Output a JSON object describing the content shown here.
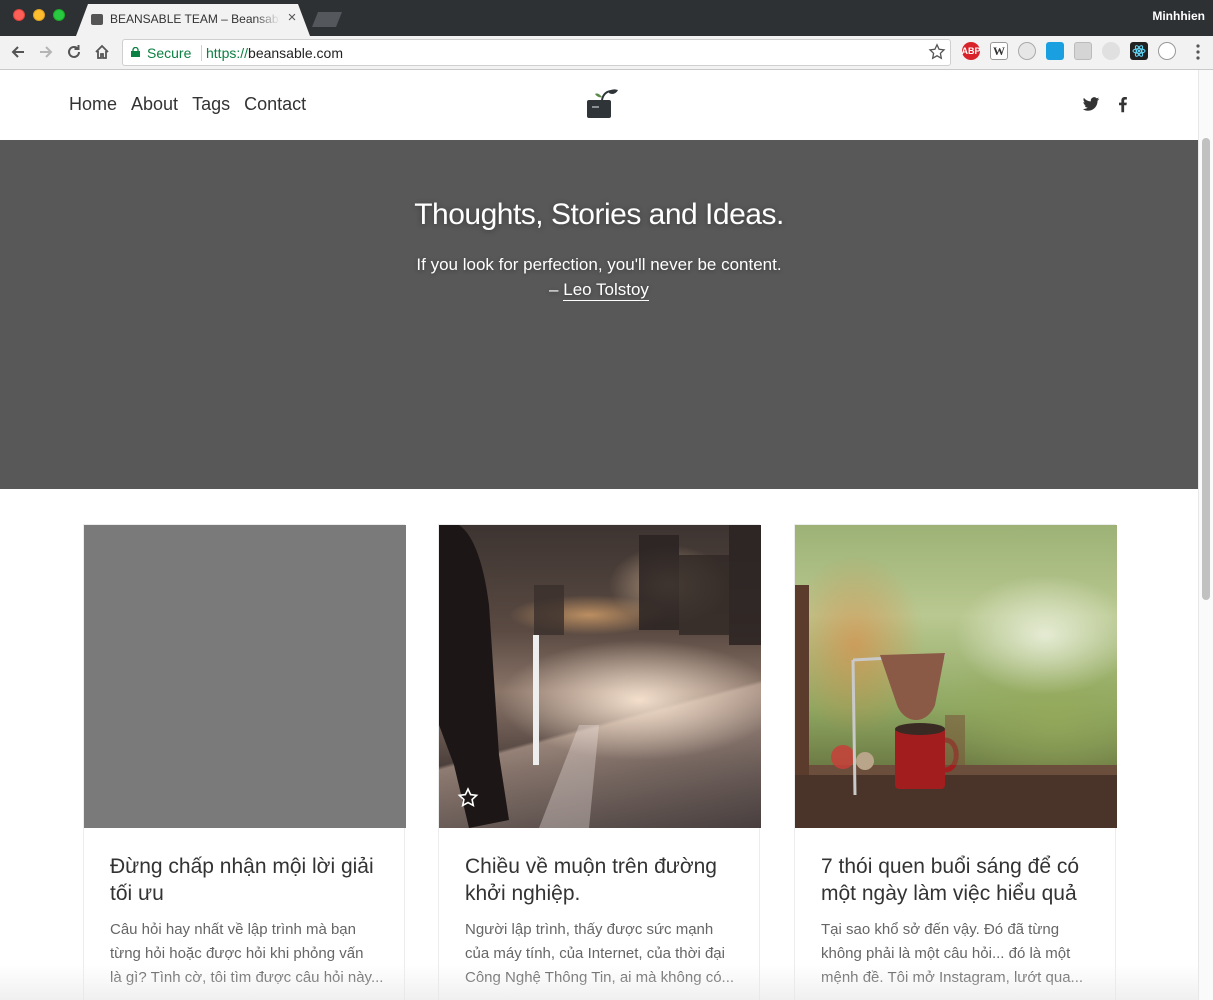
{
  "browser": {
    "tab_title": "BEANSABLE TEAM – Beansable",
    "tab_close": "×",
    "profile_name": "Minhhien",
    "secure_label": "Secure",
    "url_scheme": "https://",
    "url_host": "beansable.com",
    "extensions": [
      "adblock-plus-icon",
      "wikipedia-icon",
      "extension-icon",
      "extension-icon",
      "extension-icon",
      "extension-icon",
      "react-devtools-icon",
      "extension-icon"
    ]
  },
  "nav": {
    "links": [
      "Home",
      "About",
      "Tags",
      "Contact"
    ]
  },
  "hero": {
    "title": "Thoughts, Stories and Ideas.",
    "quote": "If you look for perfection, you'll never be content.",
    "dash": "– ",
    "author": "Leo Tolstoy"
  },
  "cards": [
    {
      "title": "Đừng chấp nhận mội lời giải tối ưu",
      "excerpt": [
        "Câu hỏi hay nhất về lập trình mà bạn",
        "từng hỏi hoặc được hỏi khi phỏng vấn",
        "là gì? Tình cờ, tôi tìm được câu hỏi này..."
      ]
    },
    {
      "title": "Chiều về muộn trên đường khởi nghiệp.",
      "excerpt": [
        "Người lập trình, thấy được sức mạnh",
        "của máy tính, của Internet, của thời đại",
        "Công Nghệ Thông Tin, ai mà không có..."
      ]
    },
    {
      "title": "7 thói quen buổi sáng để có một ngày làm việc hiểu quả",
      "excerpt": [
        "Tại sao khổ sở đến vậy. Đó đã từng",
        "không phải là một câu hỏi... đó là một",
        "mệnh đề. Tôi mở Instagram, lướt qua..."
      ]
    }
  ],
  "colors": {
    "hero_bg": "#585858",
    "secure_green": "#0b8043",
    "text_dark": "#333333",
    "text_muted": "#666666"
  }
}
